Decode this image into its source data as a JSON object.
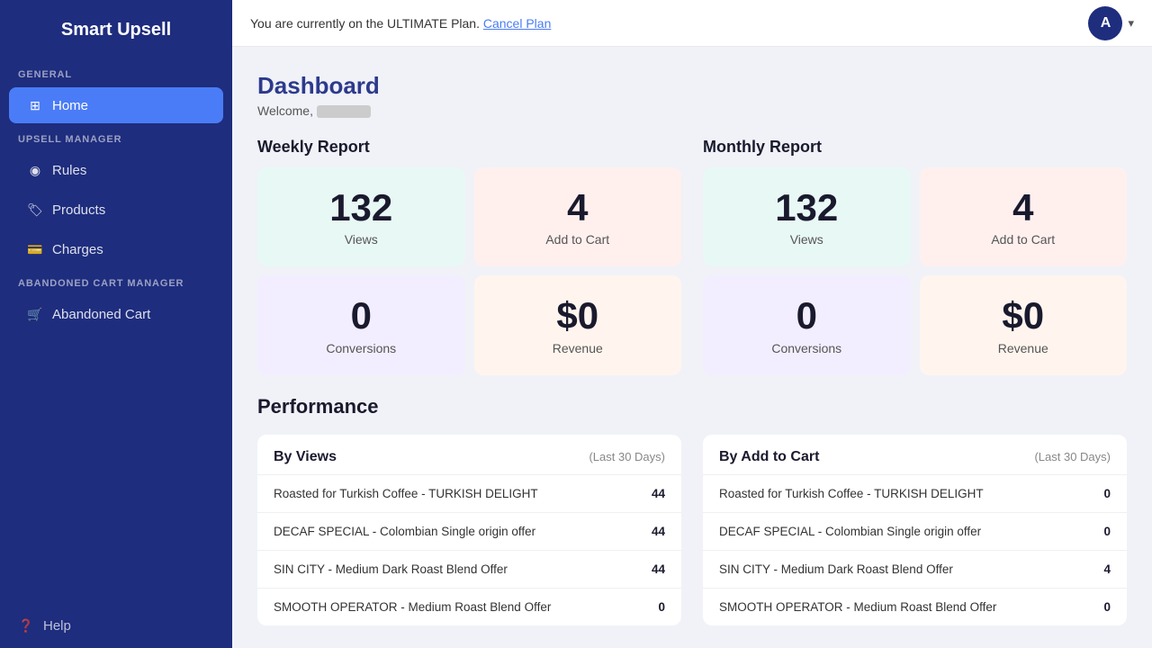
{
  "app": {
    "title": "Smart Upsell"
  },
  "topbar": {
    "plan_text": "You are currently on the ULTIMATE Plan.",
    "cancel_link": "Cancel Plan",
    "avatar_initial": "A"
  },
  "sidebar": {
    "general_label": "GENERAL",
    "home_label": "Home",
    "upsell_label": "UPSELL MANAGER",
    "rules_label": "Rules",
    "products_label": "Products",
    "charges_label": "Charges",
    "abandoned_label": "ABANDONED CART MANAGER",
    "abandoned_cart_label": "Abandoned Cart",
    "help_label": "Help"
  },
  "dashboard": {
    "title": "Dashboard",
    "welcome_prefix": "Welcome,"
  },
  "weekly": {
    "title": "Weekly Report",
    "views_value": "132",
    "views_label": "Views",
    "add_to_cart_value": "4",
    "add_to_cart_label": "Add to Cart",
    "conversions_value": "0",
    "conversions_label": "Conversions",
    "revenue_value": "$0",
    "revenue_label": "Revenue"
  },
  "monthly": {
    "title": "Monthly Report",
    "views_value": "132",
    "views_label": "Views",
    "add_to_cart_value": "4",
    "add_to_cart_label": "Add to Cart",
    "conversions_value": "0",
    "conversions_label": "Conversions",
    "revenue_value": "$0",
    "revenue_label": "Revenue"
  },
  "performance": {
    "title": "Performance",
    "by_views": {
      "title": "By Views",
      "subtitle": "(Last 30 Days)",
      "rows": [
        {
          "name": "Roasted for Turkish Coffee - TURKISH DELIGHT",
          "value": "44"
        },
        {
          "name": "DECAF SPECIAL - Colombian Single origin offer",
          "value": "44"
        },
        {
          "name": "SIN CITY - Medium Dark Roast Blend Offer",
          "value": "44"
        },
        {
          "name": "SMOOTH OPERATOR - Medium Roast Blend Offer",
          "value": "0"
        }
      ]
    },
    "by_add_to_cart": {
      "title": "By Add to Cart",
      "subtitle": "(Last 30 Days)",
      "rows": [
        {
          "name": "Roasted for Turkish Coffee - TURKISH DELIGHT",
          "value": "0"
        },
        {
          "name": "DECAF SPECIAL - Colombian Single origin offer",
          "value": "0"
        },
        {
          "name": "SIN CITY - Medium Dark Roast Blend Offer",
          "value": "4"
        },
        {
          "name": "SMOOTH OPERATOR - Medium Roast Blend Offer",
          "value": "0"
        }
      ]
    }
  }
}
